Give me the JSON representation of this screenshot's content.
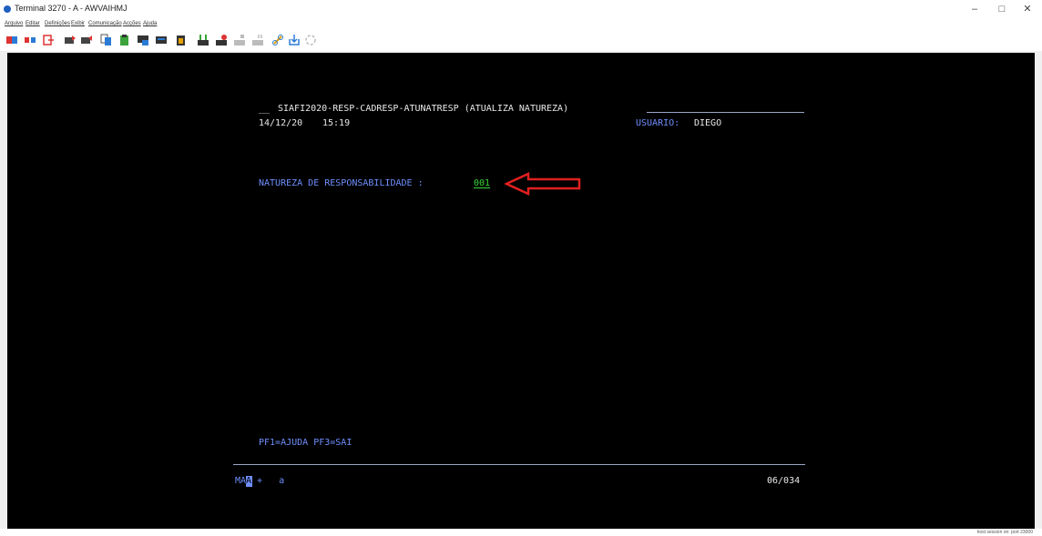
{
  "window": {
    "title": "Terminal 3270 - A - AWVAIHMJ",
    "controls": {
      "minimize": "–",
      "maximize": "□",
      "close": "✕"
    }
  },
  "menu": [
    "Arquivo",
    "Editar",
    "Definições",
    "Exibir",
    "Comunicação",
    "Acções",
    "Ajuda"
  ],
  "toolbar": {
    "icons": [
      "connect-icon",
      "disconnect-icon",
      "exit-icon",
      "send-file-icon",
      "receive-file-icon",
      "copy-icon",
      "paste-icon",
      "screen-copy-icon",
      "keyboard-icon",
      "clipboard-icon",
      "macro-play-icon",
      "macro-record-icon",
      "macro-stop-icon",
      "macro-pause-icon",
      "link-icon",
      "download-icon",
      "refresh-icon"
    ]
  },
  "terminal": {
    "header_prefix": "__",
    "header_title": "SIAFI2020-RESP-CADRESP-ATUNATRESP (ATUALIZA NATUREZA)",
    "date": "14/12/20",
    "time": "15:19",
    "user_label": "USUARIO:",
    "user_value": "DIEGO",
    "field_label": "NATUREZA DE RESPONSABILIDADE :",
    "field_value": "001",
    "pf_keys": "PF1=AJUDA PF3=SAI",
    "oia_left": "MA",
    "oia_cursor": "A",
    "oia_mid": "+   a",
    "oia_right": "06/034"
  },
  "statusbar": {
    "text": "host session on: port 23000"
  },
  "colors": {
    "terminal_bg": "#000000",
    "text_white": "#e8e8e8",
    "text_blue": "#6f8fff",
    "text_green": "#36d836",
    "annotation_arrow": "#e02020"
  }
}
